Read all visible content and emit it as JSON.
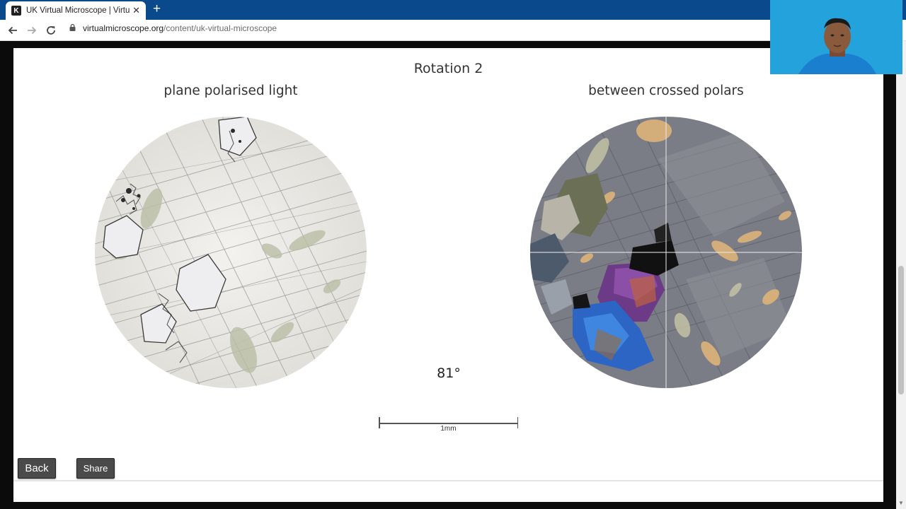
{
  "browser": {
    "tab_title": "UK Virtual Microscope | Virtual M",
    "tab_close": "✕",
    "new_tab": "+",
    "favicon_letter": "K",
    "url_host": "virtualmicroscope.org",
    "url_path": "/content/uk-virtual-microscope",
    "back_icon": "arrow-left-icon",
    "forward_icon": "arrow-right-icon",
    "reload_icon": "reload-icon"
  },
  "viewer": {
    "title": "Rotation 2",
    "ppl_label": "plane polarised light",
    "xpl_label": "between crossed polars",
    "angle": "81°",
    "scale_label": "1mm"
  },
  "buttons": {
    "back": "Back",
    "share": "Share"
  },
  "colors": {
    "chrome_blue": "#0a4a8c",
    "button_dark": "#4a4a4a",
    "webcam_bg": "#1d9ed9"
  }
}
